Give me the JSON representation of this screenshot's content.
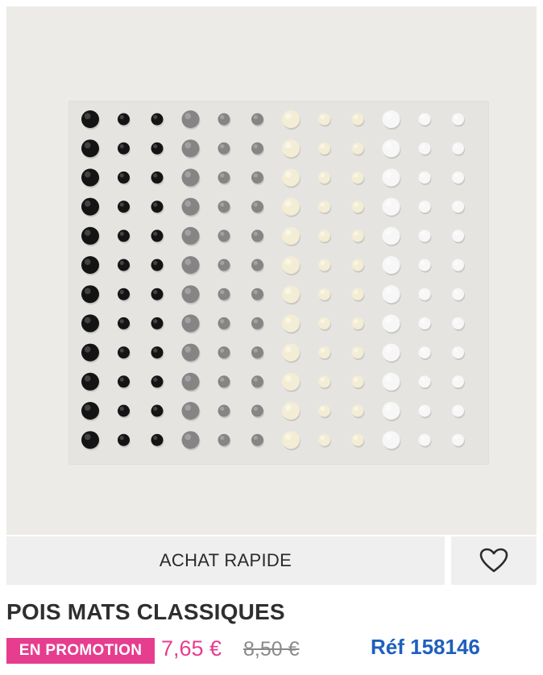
{
  "image": {
    "alt": "Pois mats classiques",
    "dot_columns": [
      {
        "color": "#141414",
        "highlight": "#6a6a6a",
        "size": "large"
      },
      {
        "color": "#141414",
        "highlight": "#6a6a6a",
        "size": "small"
      },
      {
        "color": "#141414",
        "highlight": "#6a6a6a",
        "size": "small"
      },
      {
        "color": "#858585",
        "highlight": "#b9b9b9",
        "size": "large"
      },
      {
        "color": "#858585",
        "highlight": "#b9b9b9",
        "size": "small"
      },
      {
        "color": "#858585",
        "highlight": "#b9b9b9",
        "size": "small"
      },
      {
        "color": "#f3edd5",
        "highlight": "#fffdf3",
        "size": "large"
      },
      {
        "color": "#f3edd5",
        "highlight": "#fffdf3",
        "size": "small"
      },
      {
        "color": "#f3edd5",
        "highlight": "#fffdf3",
        "size": "small"
      },
      {
        "color": "#f7f7f7",
        "highlight": "#ffffff",
        "size": "large"
      },
      {
        "color": "#f7f7f7",
        "highlight": "#ffffff",
        "size": "small"
      },
      {
        "color": "#f7f7f7",
        "highlight": "#ffffff",
        "size": "small"
      }
    ],
    "dot_rows": 12
  },
  "actions": {
    "quick_buy_label": "ACHAT RAPIDE",
    "wishlist_icon": "heart-outline-icon"
  },
  "product": {
    "title": "POIS MATS CLASSIQUES",
    "promo_badge": "EN PROMOTION",
    "sale_price": "7,65 €",
    "original_price": "8,50 €",
    "reference": "Réf 158146"
  },
  "colors": {
    "promo": "#e63d8f",
    "reference": "#1f5fbf",
    "button_bg": "#efefef"
  }
}
